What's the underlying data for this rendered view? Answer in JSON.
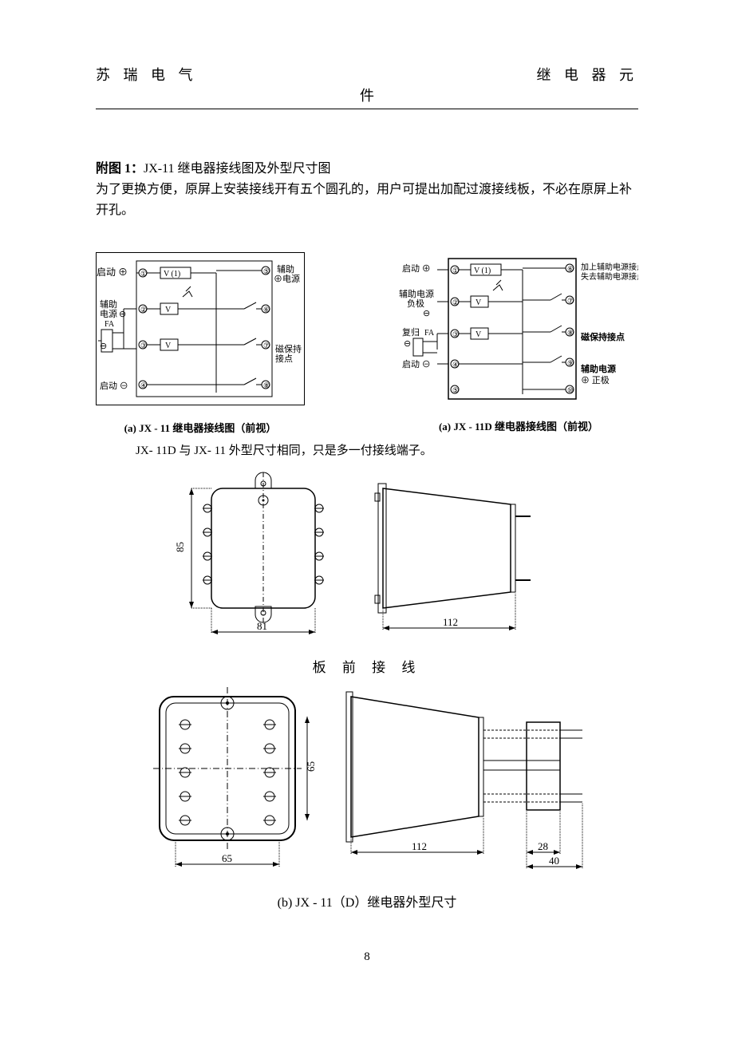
{
  "header": {
    "left": "苏 瑞 电 气",
    "mid": "件",
    "right": "继 电 器 元"
  },
  "title": {
    "prefix": "附图 1：",
    "rest": "JX-11 继电器接线图及外型尺寸图"
  },
  "intro": "为了更换方便，原屏上安装接线开有五个圆孔的，用户可提出加配过渡接线板，不必在原屏上补开孔。",
  "schemA": {
    "left_labels": {
      "l1": "启动 ⊕",
      "l2a": "辅助",
      "l2b": "电源",
      "l2c": "⊖",
      "l2d": "FA",
      "l3": "⊖",
      "l4": "启动 ⊖"
    },
    "right_labels": {
      "r1a": "辅助",
      "r1b": "⊕电源",
      "r2a": "磁保持",
      "r2b": "接点"
    },
    "pins": {
      "p1": "①",
      "p2": "②",
      "p3": "③",
      "p4": "④",
      "p5": "⑤",
      "p6": "⑥",
      "p7": "⑦",
      "p8": "⑧"
    },
    "v_top": "V (1)",
    "v": "V",
    "caption": "(a) JX - 11 继电器接线图（前视）"
  },
  "schemB": {
    "left_labels": {
      "l1": "启动 ⊕",
      "l2a": "辅助电源",
      "l2b": "负极",
      "l2c": "⊖",
      "l3a": "复归",
      "l3b": "FA",
      "l3c": "⊖",
      "l4": "启动 ⊖",
      "l5": "⑤"
    },
    "right_labels": {
      "r1": "加上辅助电源接点保持",
      "r1b": "失去辅助电源接点返回",
      "r2": "磁保持接点",
      "r3a": "辅助电源",
      "r3b": "⊕ 正极"
    },
    "pins": {
      "p1": "①",
      "p2": "②",
      "p3": "③",
      "p4": "④",
      "p6": "⑥",
      "p7": "⑦",
      "p8": "⑧",
      "p9": "⑨",
      "p10": "⑩"
    },
    "v_top": "V (1)",
    "v": "V",
    "caption": "(a) JX - 11D 继电器接线图（前视）"
  },
  "note": "JX- 11D 与 JX- 11 外型尺寸相同，只是多一付接线端子。",
  "dims": {
    "d85": "85",
    "d81": "81",
    "d112a": "112",
    "d65v": "65",
    "d65h": "65",
    "d112b": "112",
    "d28": "28",
    "d40": "40"
  },
  "mid_label": "板 前 接 线",
  "caption_b": "(b)  JX - 11（D）继电器外型尺寸",
  "page_num": "8"
}
